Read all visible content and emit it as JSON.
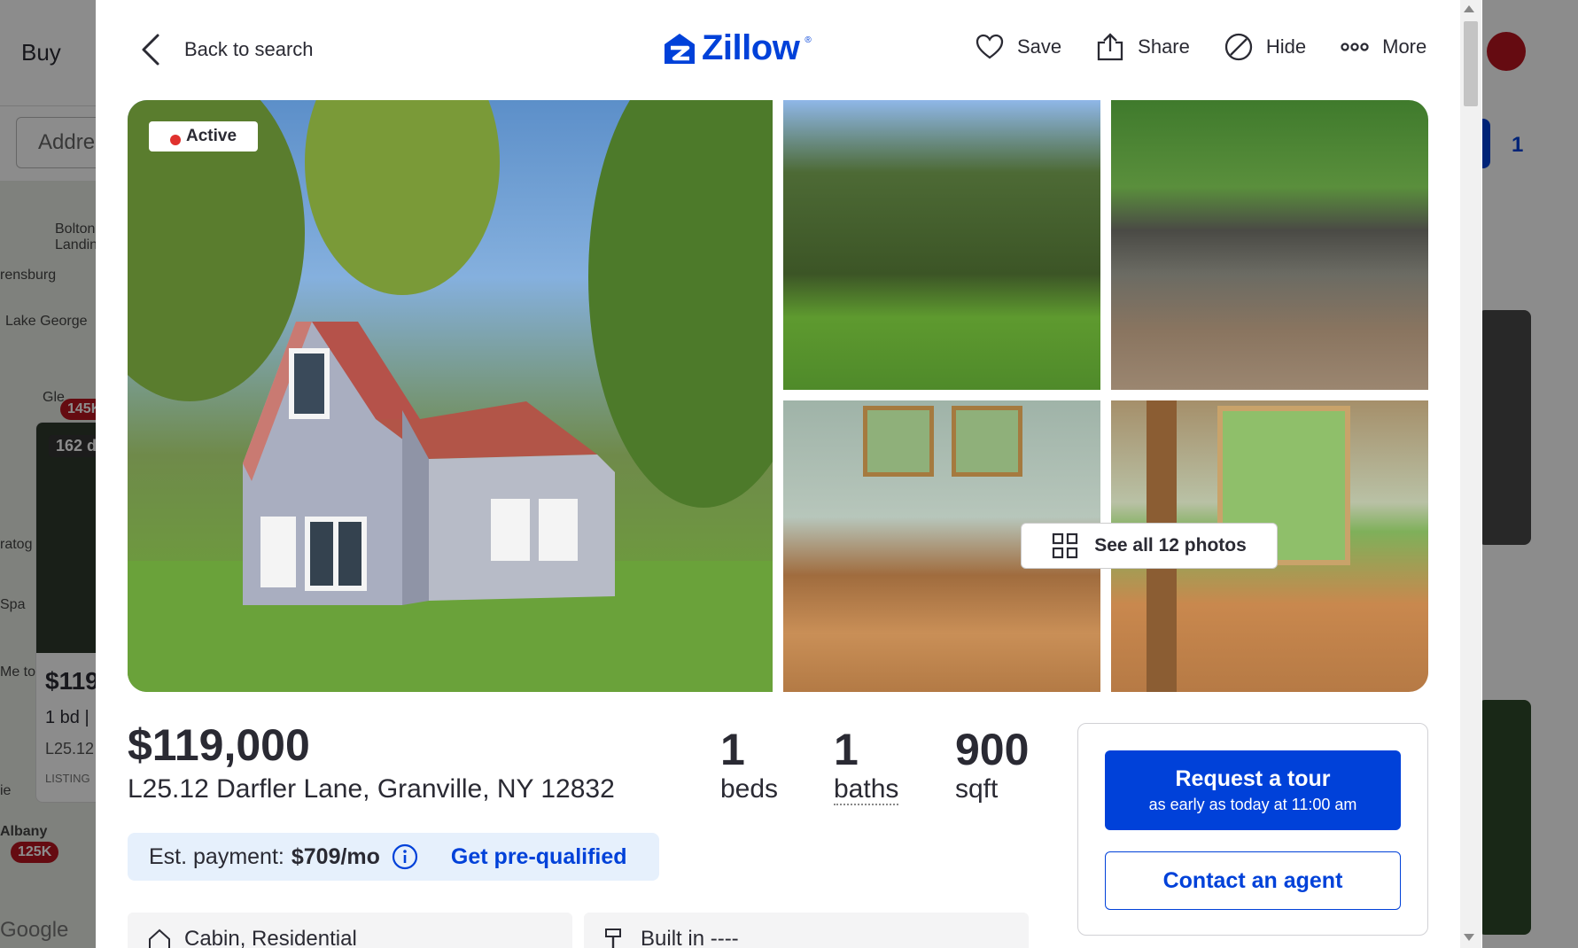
{
  "background": {
    "nav_buy": "Buy",
    "search_placeholder": "Addre",
    "map_labels": [
      "Bolton Landin",
      "rensburg",
      "Lake George",
      "Gle",
      "ratog pring",
      "Spa",
      "Me ton P",
      "ie",
      "Albany",
      "Google"
    ],
    "map_pins": [
      "145K",
      "125K"
    ],
    "card": {
      "badge": "162 d",
      "price": "$119",
      "beds": "1 bd |",
      "address": "L25.12",
      "listing": "LISTING"
    },
    "saved_count": "1"
  },
  "header": {
    "back_label": "Back to search",
    "logo": "Zillow",
    "actions": [
      {
        "icon": "heart-icon",
        "label": "Save"
      },
      {
        "icon": "share-icon",
        "label": "Share"
      },
      {
        "icon": "hide-icon",
        "label": "Hide"
      },
      {
        "icon": "more-icon",
        "label": "More"
      }
    ]
  },
  "gallery": {
    "status": "Active",
    "see_all": "See all 12 photos"
  },
  "summary": {
    "price": "$119,000",
    "address": "L25.12 Darfler Lane, Granville, NY 12832",
    "beds": {
      "value": "1",
      "label": "beds"
    },
    "baths": {
      "value": "1",
      "label": "baths"
    },
    "sqft": {
      "value": "900",
      "label": "sqft"
    }
  },
  "payment": {
    "label": "Est. payment:",
    "amount": "$709/mo",
    "prequal": "Get pre-qualified"
  },
  "facts": [
    {
      "icon": "home-icon",
      "text": "Cabin, Residential"
    },
    {
      "icon": "hammer-icon",
      "text": "Built in ----"
    }
  ],
  "contact": {
    "tour_title": "Request a tour",
    "tour_sub": "as early as today at 11:00 am",
    "agent": "Contact an agent"
  },
  "colors": {
    "brand": "#0041d9",
    "active_dot": "#e0312e"
  }
}
